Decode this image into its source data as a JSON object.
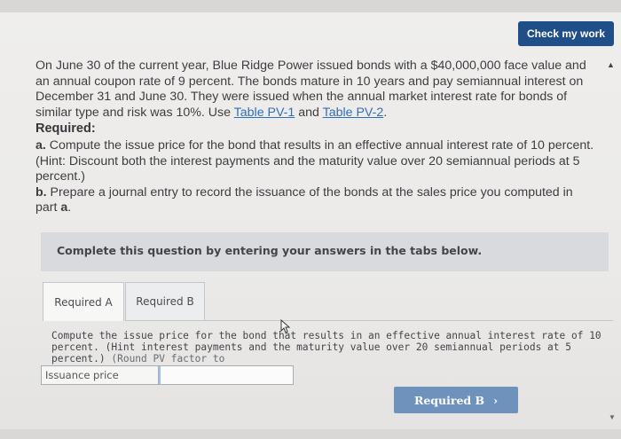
{
  "header": {
    "check_label": "Check my work"
  },
  "problem": {
    "text_before": "On June 30 of the current year, Blue Ridge Power issued bonds with a $40,000,000 face value and an annual coupon rate of 9 percent. The bonds mature in 10 years and pay semiannual interest on December 31 and June 30. They were issued when the annual market interest rate for bonds of similar type and risk was 10%. Use ",
    "link1": "Table PV-1",
    "between": " and ",
    "link2": "Table PV-2",
    "after": "."
  },
  "required": {
    "heading": "Required:",
    "a_letter": "a.",
    "a_text": " Compute the issue price for the bond that results in an effective annual interest rate of 10 percent. (Hint: Discount both the interest payments and the maturity value over 20 semiannual periods at 5 percent.)",
    "b_letter": "b.",
    "b_text": " Prepare a journal entry to record the issuance of the bonds at the sales price you computed in part ",
    "b_ref": "a",
    "b_end": "."
  },
  "panel": {
    "text": "Complete this question by entering your answers in the tabs below."
  },
  "tabs": [
    {
      "label": "Required A"
    },
    {
      "label": "Required B"
    }
  ],
  "instruction": {
    "text": "Compute the issue price for the bond that results in an effective annual interest rate of 10 percent. (Hint interest payments and the maturity value over 20 semiannual periods at 5 percent.) ",
    "round": "(Round PV factor to"
  },
  "form": {
    "issuance_label": "Issuance price",
    "issuance_value": ""
  },
  "nav": {
    "next_label": "Required B",
    "next_arrow": "›"
  },
  "colors": {
    "primary": "#1f4f86",
    "next_button": "#6f92bd",
    "link": "#2f6fb8"
  }
}
